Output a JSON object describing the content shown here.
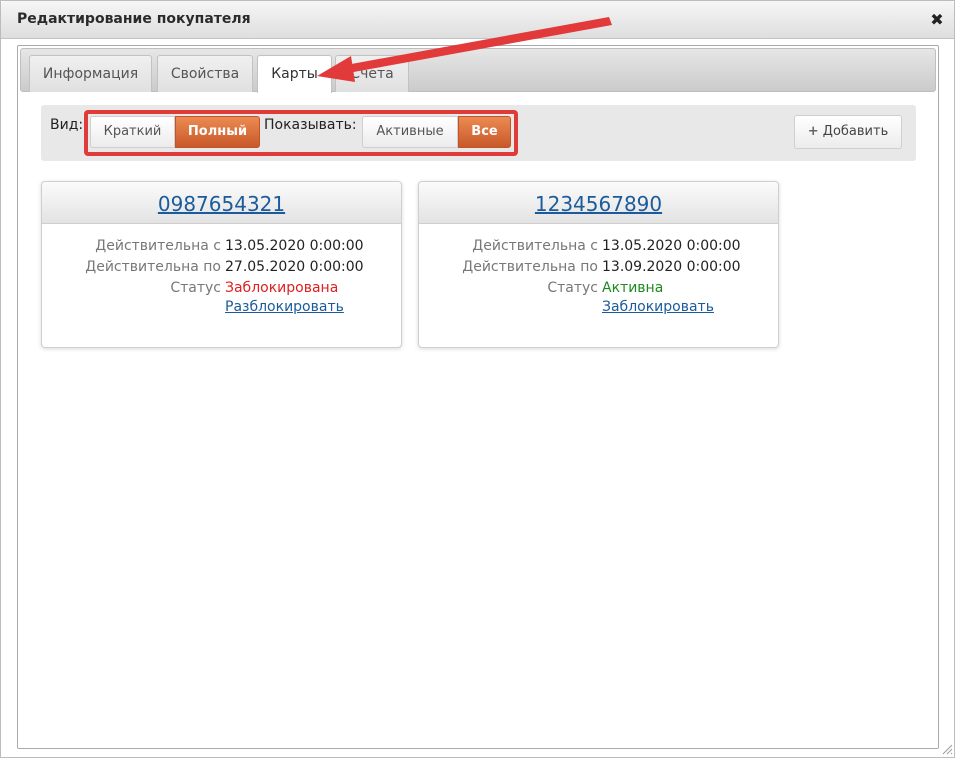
{
  "dialog": {
    "title": "Редактирование покупателя",
    "close_icon": "close-icon",
    "close_glyph": "✖"
  },
  "tabs": [
    {
      "label": "Информация",
      "active": false
    },
    {
      "label": "Свойства",
      "active": false
    },
    {
      "label": "Карты",
      "active": true
    },
    {
      "label": "Счета",
      "active": false
    }
  ],
  "filters": {
    "view_label": "Вид:",
    "view_options": [
      {
        "label": "Краткий",
        "selected": false
      },
      {
        "label": "Полный",
        "selected": true
      }
    ],
    "show_label": "Показывать:",
    "show_options": [
      {
        "label": "Активные",
        "selected": false
      },
      {
        "label": "Все",
        "selected": true
      }
    ],
    "add_button_label": "Добавить",
    "add_icon": "plus-icon"
  },
  "cards": [
    {
      "number": "0987654321",
      "valid_from_label": "Действительна с",
      "valid_from": "13.05.2020 0:00:00",
      "valid_to_label": "Действительна по",
      "valid_to": "27.05.2020 0:00:00",
      "status_label": "Статус",
      "status": "Заблокирована",
      "action": "Разблокировать"
    },
    {
      "number": "1234567890",
      "valid_from_label": "Действительна с",
      "valid_from": "13.05.2020 0:00:00",
      "valid_to_label": "Действительна по",
      "valid_to": "13.09.2020 0:00:00",
      "status_label": "Статус",
      "status": "Активна",
      "action": "Заблокировать"
    }
  ],
  "colors": {
    "accent_orange": "#d96a35",
    "annotation_red": "#e03b3b",
    "link_blue": "#1b5b9b",
    "status_blocked": "#e02020",
    "status_active": "#1d8a1d"
  }
}
